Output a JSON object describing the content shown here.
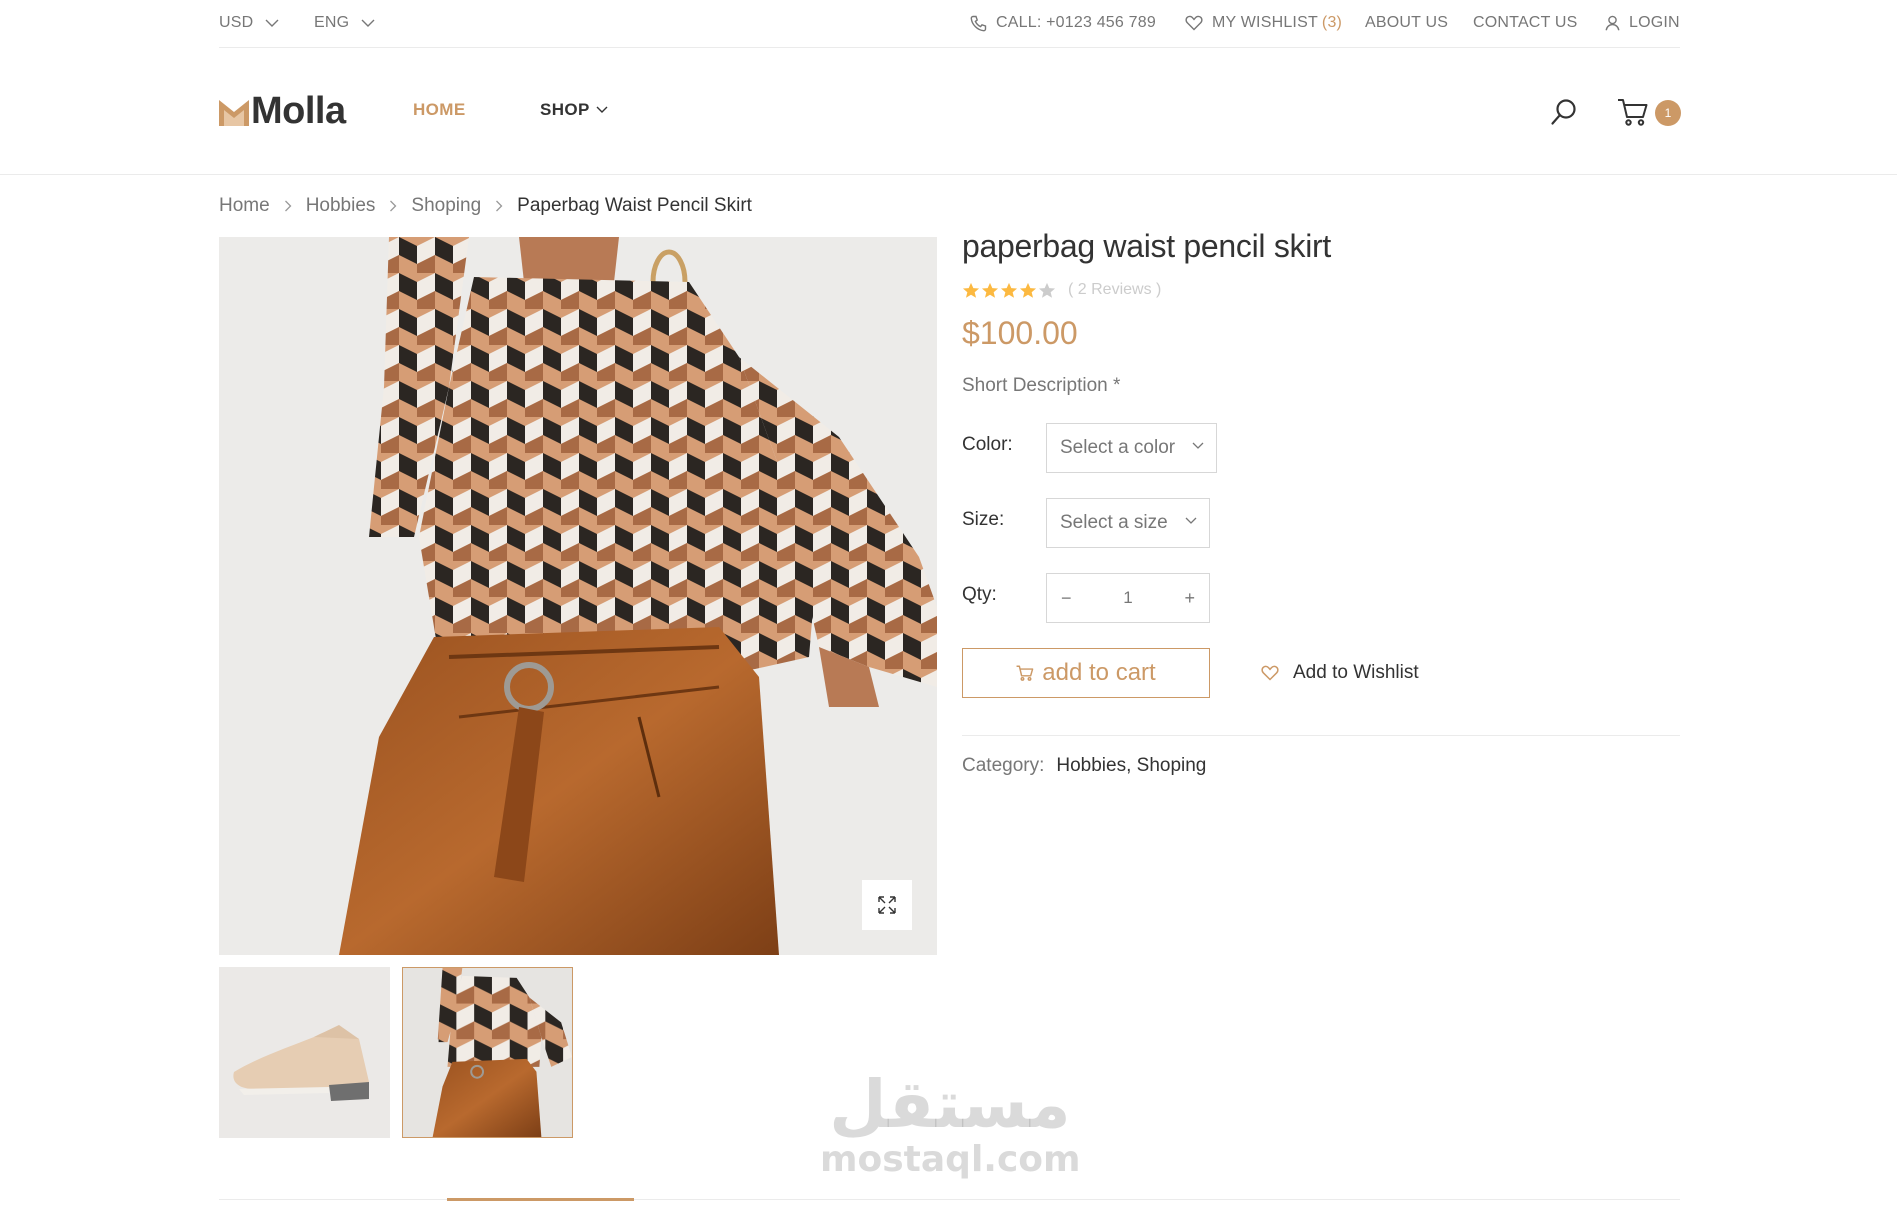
{
  "topbar": {
    "currency": "USD",
    "language": "ENG",
    "call": "CALL: +0123 456 789",
    "wishlist_label": "MY WISHLIST",
    "wishlist_count": "(3)",
    "about": "ABOUT US",
    "contact": "CONTACT US",
    "login": "LOGIN"
  },
  "header": {
    "logo": "Molla",
    "nav": {
      "home": "HOME",
      "shop": "SHOP"
    },
    "cart_count": "1"
  },
  "breadcrumb": [
    "Home",
    "Hobbies",
    "Shoping",
    "Paperbag Waist Pencil Skirt"
  ],
  "product": {
    "title": "paperbag waist pencil skirt",
    "rating": 4,
    "rating_max": 5,
    "reviews": "( 2 Reviews )",
    "price": "$100.00",
    "short_description": "Short Description *",
    "color_label": "Color:",
    "color_placeholder": "Select a color",
    "size_label": "Size:",
    "size_placeholder": "Select a size",
    "qty_label": "Qty:",
    "qty_value": "1",
    "qty_minus": "−",
    "qty_plus": "+",
    "add_to_cart": "add to cart",
    "add_to_wishlist": "Add to Wishlist",
    "category_label": "Category:",
    "category_values": "Hobbies, Shoping"
  },
  "watermark": {
    "arabic": "مستقل",
    "latin": "mostaql.com"
  },
  "colors": {
    "accent": "#cc9966",
    "text": "#333333",
    "muted": "#777777",
    "border": "#ebebeb"
  },
  "icons": [
    "chevron-down-icon",
    "phone-icon",
    "heart-icon",
    "user-icon",
    "search-icon",
    "cart-icon",
    "chevron-right-icon",
    "expand-icon",
    "star-icon"
  ]
}
